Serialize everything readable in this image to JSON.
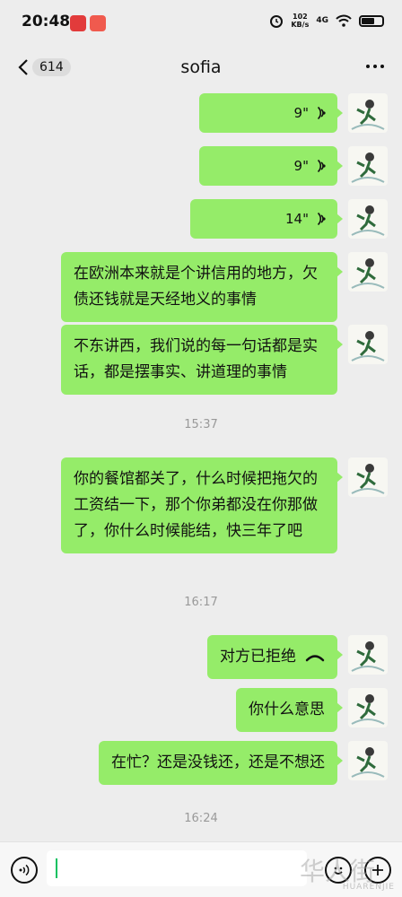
{
  "status_bar": {
    "time": "20:48",
    "speed_value": "102",
    "speed_unit": "KB/s",
    "network": "4G"
  },
  "header": {
    "unread_count": "614",
    "title": "sofia"
  },
  "messages": [
    {
      "type": "voice",
      "duration": "9\""
    },
    {
      "type": "voice",
      "duration": "9\""
    },
    {
      "type": "voice",
      "duration": "14\""
    },
    {
      "type": "text",
      "text": "在欧洲本来就是个讲信用的地方，欠债还钱就是天经地义的事情"
    },
    {
      "type": "text",
      "text": "不东讲西，我们说的每一句话都是实话，都是摆事实、讲道理的事情"
    },
    {
      "type": "text",
      "text": "你的餐馆都关了，什么时候把拖欠的工资结一下，那个你弟都没在你那做了，你什么时候能结，快三年了吧"
    },
    {
      "type": "call",
      "text": "对方已拒绝"
    },
    {
      "type": "text",
      "text": "你什么意思"
    },
    {
      "type": "text",
      "text": "在忙？还是没钱还，还是不想还"
    }
  ],
  "timestamps": [
    "15:37",
    "16:17",
    "16:24"
  ],
  "watermark": {
    "main": "华人街",
    "sub": "HUARENJIE"
  },
  "colors": {
    "bubble": "#95ec69",
    "background": "#ededed",
    "caret": "#07c160"
  }
}
